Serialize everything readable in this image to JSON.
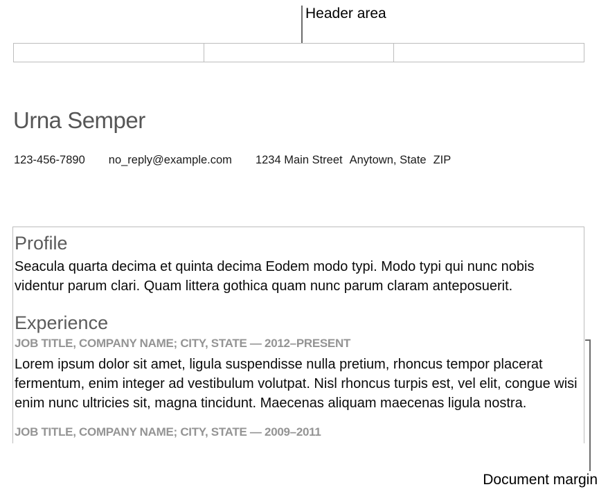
{
  "callouts": {
    "header": "Header area",
    "margin": "Document margin"
  },
  "document": {
    "name": "Urna Semper",
    "contact": {
      "phone": "123-456-7890",
      "email": "no_reply@example.com",
      "street": "1234 Main Street",
      "citystate": "Anytown, State",
      "zip": "ZIP"
    },
    "profile": {
      "heading": "Profile",
      "text": "Seacula quarta decima et quinta decima Eodem modo typi. Modo typi qui nunc nobis videntur parum clari. Quam littera gothica quam nunc parum claram anteposuerit."
    },
    "experience": {
      "heading": "Experience",
      "jobs": [
        {
          "line": "JOB TITLE, COMPANY NAME; CITY, STATE — 2012–PRESENT",
          "desc": "Lorem ipsum dolor sit amet, ligula suspendisse nulla pretium, rhoncus tempor placerat fermentum, enim integer ad vestibulum volutpat. Nisl rhoncus turpis est, vel elit, congue wisi enim nunc ultricies sit, magna tincidunt. Maecenas aliquam maecenas ligula nostra."
        },
        {
          "line": "JOB TITLE, COMPANY NAME; CITY, STATE — 2009–2011",
          "desc": ""
        }
      ]
    }
  }
}
